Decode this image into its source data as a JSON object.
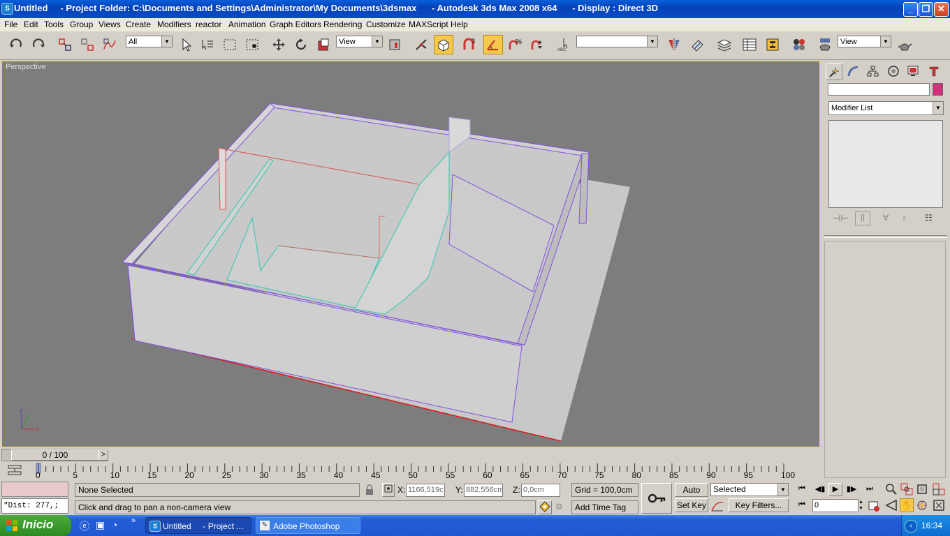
{
  "window": {
    "title": "Untitled     - Project Folder: C:\\Documents and Settings\\Administrator\\My Documents\\3dsmax      - Autodesk 3ds Max 2008 x64      - Display : Direct 3D",
    "minimize_label": "_",
    "restore_label": "❐",
    "close_label": "✕"
  },
  "menu": [
    "File",
    "Edit",
    "Tools",
    "Group",
    "Views",
    "Create",
    "Modifiers",
    "reactor",
    "Animation",
    "Graph Editors",
    "Rendering",
    "Customize",
    "MAXScript",
    "Help"
  ],
  "toolbar": {
    "selection_filter": "All",
    "reference_coord": "View",
    "named_selection": "",
    "render_view": "View"
  },
  "viewport": {
    "label": "Perspective"
  },
  "command_panel": {
    "object_name": "",
    "object_color": "#d1307a",
    "modifier_list": "Modifier List"
  },
  "time_slider": {
    "label": "0 / 100",
    "ticks": [
      0,
      5,
      10,
      15,
      20,
      25,
      30,
      35,
      40,
      45,
      50,
      55,
      60,
      65,
      70,
      75,
      80,
      85,
      90,
      95,
      100
    ]
  },
  "status": {
    "selection": "None Selected",
    "prompt": "Click and drag to pan a non-camera view",
    "script_line": "\"Dist: 277,;",
    "x_label": "X:",
    "x_value": "1166,519c",
    "y_label": "Y:",
    "y_value": "882,556cm",
    "z_label": "Z:",
    "z_value": "0,0cm",
    "grid": "Grid = 100,0cm",
    "add_time_tag": "Add Time Tag",
    "auto_key": "Auto Key",
    "set_key": "Set Key",
    "key_mode": "Selected",
    "key_filters": "Key Filters...",
    "frame": "0"
  },
  "taskbar": {
    "start": "Inicio",
    "tasks": [
      "Untitled     - Project ...",
      "Adobe Photoshop"
    ],
    "clock": "16:34"
  }
}
